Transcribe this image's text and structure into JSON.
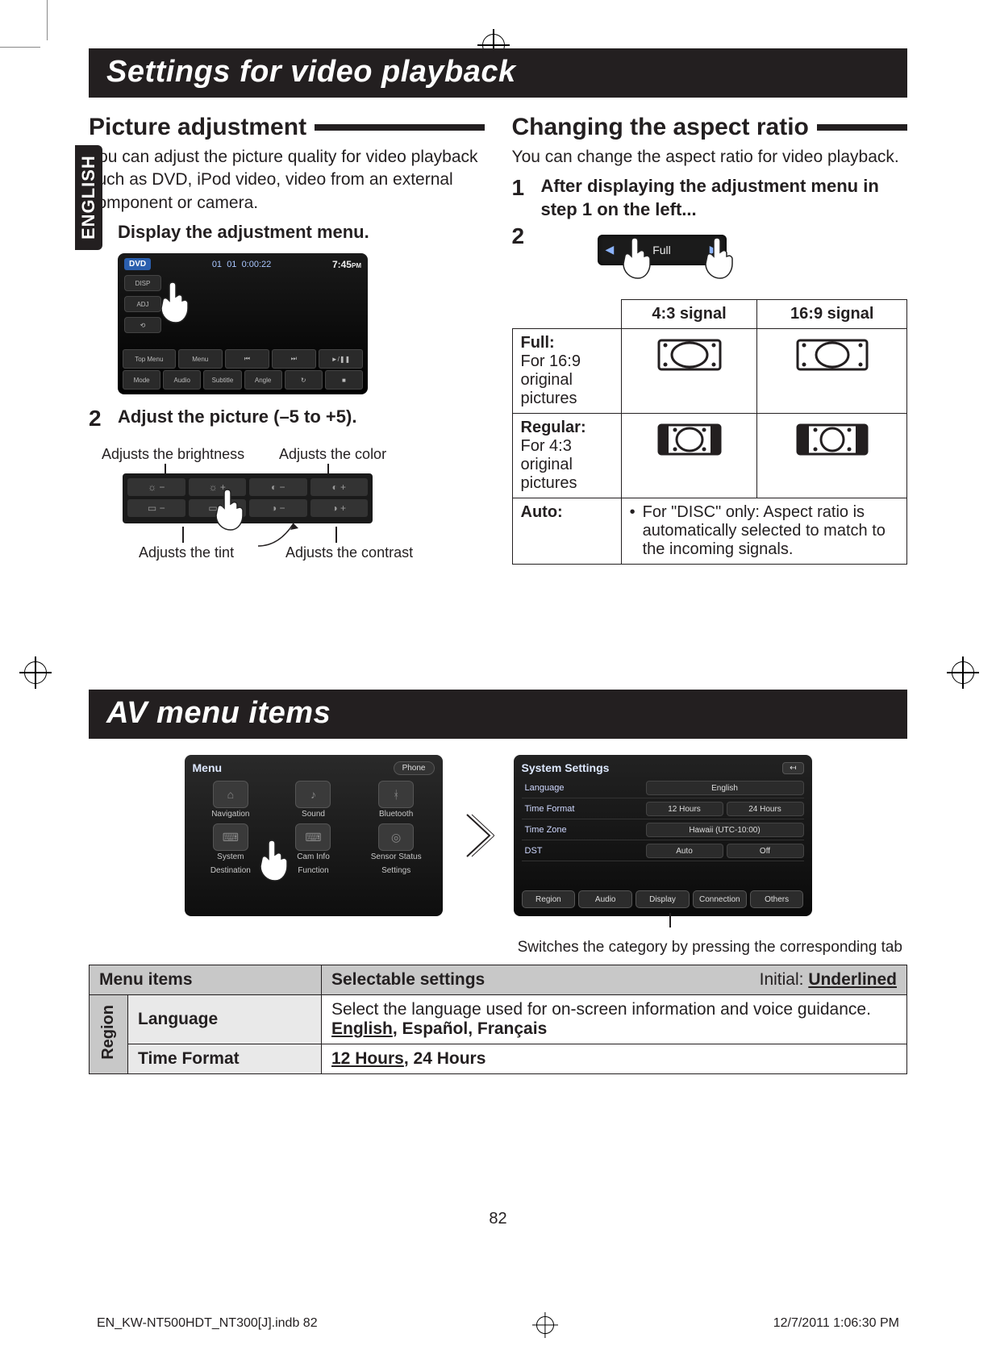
{
  "lang_tab": "ENGLISH",
  "title1": "Settings for video playback",
  "picture": {
    "heading": "Picture adjustment",
    "intro": "You can adjust the picture quality for video playback such as DVD, iPod video, video from an external component or camera.",
    "step1": "Display the adjustment menu.",
    "step2": "Adjust the picture (–5 to +5).",
    "label_brightness": "Adjusts the brightness",
    "label_color": "Adjusts the color",
    "label_tint": "Adjusts the tint",
    "label_contrast": "Adjusts the contrast",
    "scr": {
      "dvd": "DVD",
      "track": "01",
      "chap": "01",
      "elapsed": "0:00:22",
      "clock": "7:45",
      "disp": "DISP",
      "adj": "ADJ",
      "mode": "Mode",
      "audio": "Audio",
      "subtitle": "Subtitle",
      "angle": "Angle",
      "topmenu": "Top Menu",
      "menu": "Menu"
    }
  },
  "aspect": {
    "heading": "Changing the aspect ratio",
    "intro": "You can change the aspect ratio for video playback.",
    "step1": "After displaying the adjustment menu in step 1 on the left...",
    "pill_label": "Full",
    "th_43": "4:3 signal",
    "th_169": "16:9 signal",
    "row_full_label": "Full:",
    "row_full_desc": "For 16:9 original pictures",
    "row_reg_label": "Regular:",
    "row_reg_desc": "For 4:3 original pictures",
    "row_auto_label": "Auto:",
    "row_auto_desc": "For \"DISC\" only: Aspect ratio is automatically selected to match to the incoming signals."
  },
  "title2": "AV menu items",
  "menu": {
    "title": "Menu",
    "items": [
      "Navigation",
      "Sound",
      "Bluetooth",
      "System",
      "Cam Info",
      "Sensor Status",
      "Destination",
      "Function",
      "Settings"
    ],
    "phone": "Phone"
  },
  "settings": {
    "title": "System Settings",
    "language_key": "Language",
    "language_val": "English",
    "timeformat_key": "Time Format",
    "timeformat_12": "12 Hours",
    "timeformat_24": "24 Hours",
    "timezone_key": "Time Zone",
    "timezone_val": "Hawaii (UTC-10:00)",
    "dst_key": "DST",
    "dst_auto": "Auto",
    "dst_off": "Off",
    "tabs": [
      "Region",
      "Audio",
      "Display",
      "Connection",
      "Others"
    ]
  },
  "caption_switch": "Switches the category by pressing the corresponding tab",
  "avtable": {
    "h_items": "Menu items",
    "h_settings": "Selectable settings",
    "h_initial_prefix": "Initial: ",
    "h_initial": "Underlined",
    "cat": "Region",
    "r1_label": "Language",
    "r1_desc": "Select the language used for on-screen information and voice guidance.",
    "r1_opts_bold_u": "English",
    "r1_opts_rest": ", Español, Français",
    "r2_label": "Time Format",
    "r2_opt_u": "12 Hours",
    "r2_opt_rest": ", 24 Hours"
  },
  "page_num": "82",
  "footer_left": "EN_KW-NT500HDT_NT300[J].indb   82",
  "footer_right": "12/7/2011   1:06:30 PM"
}
